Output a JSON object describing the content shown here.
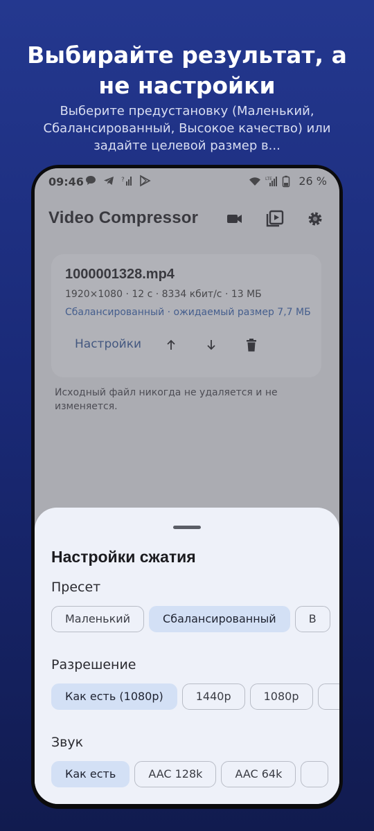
{
  "promo": {
    "title": "Выбирайте результат, а не настройки",
    "subtitle": "Выберите предустановку (Маленький, Сбалансированный, Высокое качество) или задайте целевой размер в..."
  },
  "status_bar": {
    "time": "09:46",
    "battery": "26 %",
    "left_icons": [
      "chat-bubble-icon",
      "telegram-icon",
      "signal-question-icon",
      "play-store-icon"
    ],
    "right_icons": [
      "wifi-icon",
      "lte-signal-icon",
      "battery-icon"
    ]
  },
  "app_bar": {
    "title": "Video Compressor",
    "actions": [
      "video-camera-icon",
      "video-library-icon",
      "settings-gear-icon"
    ]
  },
  "file_card": {
    "name": "1000001328.mp4",
    "meta": "1920×1080 · 12 с · 8334 кбит/с · 13 МБ",
    "estimate": "Сбалансированный · ожидаемый размер 7,7 МБ",
    "settings_label": "Настройки",
    "actions": [
      "arrow-up-icon",
      "arrow-down-icon",
      "delete-icon"
    ]
  },
  "note": "Исходный файл никогда не удаляется и не изменяется.",
  "sheet": {
    "title": "Настройки сжатия",
    "preset": {
      "label": "Пресет",
      "options": [
        "Маленький",
        "Сбалансированный",
        "В"
      ],
      "selected": "Сбалансированный"
    },
    "resolution": {
      "label": "Разрешение",
      "options": [
        "Как есть (1080p)",
        "1440p",
        "1080p",
        ""
      ],
      "selected": "Как есть (1080p)"
    },
    "audio": {
      "label": "Звук",
      "options": [
        "Как есть",
        "AAC 128k",
        "AAC 64k",
        ""
      ],
      "selected": "Как есть"
    }
  },
  "colors": {
    "background_top": "#24388f",
    "background_bottom": "#111b4f",
    "accent_text": "#2f5aa6",
    "chip_selected": "#d3e0f5",
    "sheet_background": "#eef1f9"
  }
}
